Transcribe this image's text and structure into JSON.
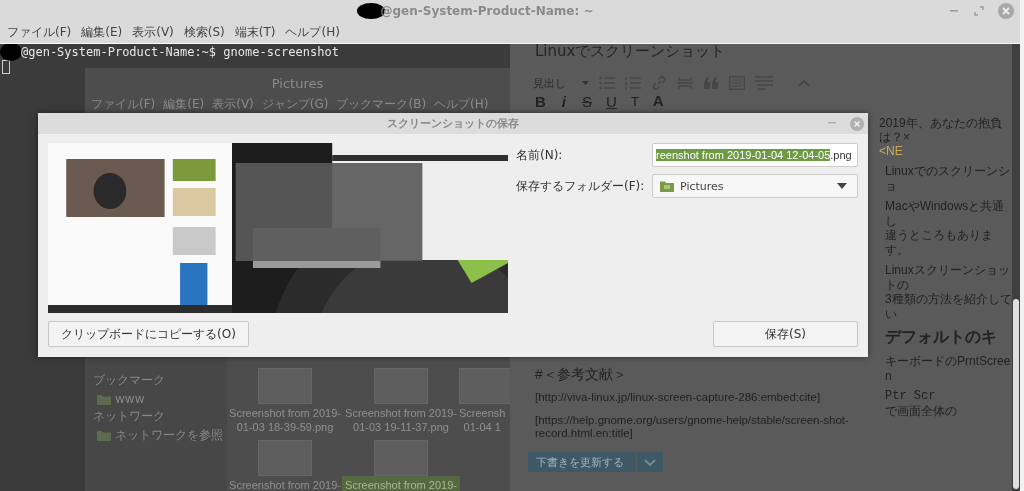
{
  "terminal": {
    "title": "@gen-System-Product-Name: ~",
    "menu": [
      "ファイル(F)",
      "編集(E)",
      "表示(V)",
      "検索(S)",
      "端末(T)",
      "ヘルプ(H)"
    ],
    "lines": [
      "@gen-System-Product-Name:~$ gnome-screenshot"
    ]
  },
  "file_manager": {
    "title": "Pictures",
    "menu": [
      "ファイル(F)",
      "編集(E)",
      "表示(V)",
      "ジャンプ(G)",
      "ブックマーク(B)",
      "ヘルプ(H)"
    ],
    "sidebar": [
      {
        "kind": "heading",
        "label": "ブックマーク"
      },
      {
        "kind": "place",
        "label": "www"
      },
      {
        "kind": "heading",
        "label": "ネットワーク"
      },
      {
        "kind": "network",
        "label": "ネットワークを参照"
      }
    ],
    "files": [
      {
        "lines": [
          "Screenshot from 2019-",
          "01-03 18-39-59.png"
        ],
        "selected": false
      },
      {
        "lines": [
          "Screenshot from 2019-",
          "01-03 19-11-37.png"
        ],
        "selected": false
      },
      {
        "lines": [
          "Screensh",
          "01-04 1"
        ],
        "selected": false
      },
      {
        "lines": [
          "Screenshot from 2019-"
        ],
        "selected": false
      },
      {
        "lines": [
          "Screenshot from 2019-"
        ],
        "selected": true
      }
    ]
  },
  "editor": {
    "title": "Linuxでスクリーンショット",
    "format_select": "見出し",
    "format_buttons": [
      {
        "kind": "bold",
        "label": "B"
      },
      {
        "kind": "italic",
        "label": "i"
      },
      {
        "kind": "strike",
        "label": "S"
      },
      {
        "kind": "underline",
        "label": "U"
      },
      {
        "kind": "size",
        "label": "T"
      },
      {
        "kind": "color",
        "label": "A"
      }
    ],
    "content": [
      "#＜参考文献＞",
      "[http://viva-linux.jp/linux-screen-capture-286:embed:cite]",
      "[https://help.gnome.org/users/gnome-help/stable/screen-shot-record.html.en:title]"
    ],
    "update_button": "下書きを更新する",
    "preview": {
      "notice": "2019年、あなたの抱負は？×",
      "notice_link": "<NE",
      "paragraphs": [
        [
          "Linuxでのスクリーンショ"
        ],
        [
          "MacやWindowsと共通し",
          "違うところもあります。"
        ],
        [
          "Linuxスクリーンショットの",
          "3種類の方法を紹介してい"
        ]
      ],
      "heading": "デフォルトのキ",
      "after": [
        "キーボードのPrntScreen"
      ],
      "code": "Ptr Scr",
      "code_after": "で画面全体の"
    }
  },
  "dialog": {
    "title": "スクリーンショットの保存",
    "name_label": "名前(N):",
    "filename_selected": "reenshot from 2019-01-04 12-04-05",
    "filename_rest": ".png",
    "folder_label": "保存するフォルダー(F):",
    "folder": "Pictures",
    "copy_button": "クリップボードにコピーする(O)",
    "save_button": "保存(S)"
  }
}
